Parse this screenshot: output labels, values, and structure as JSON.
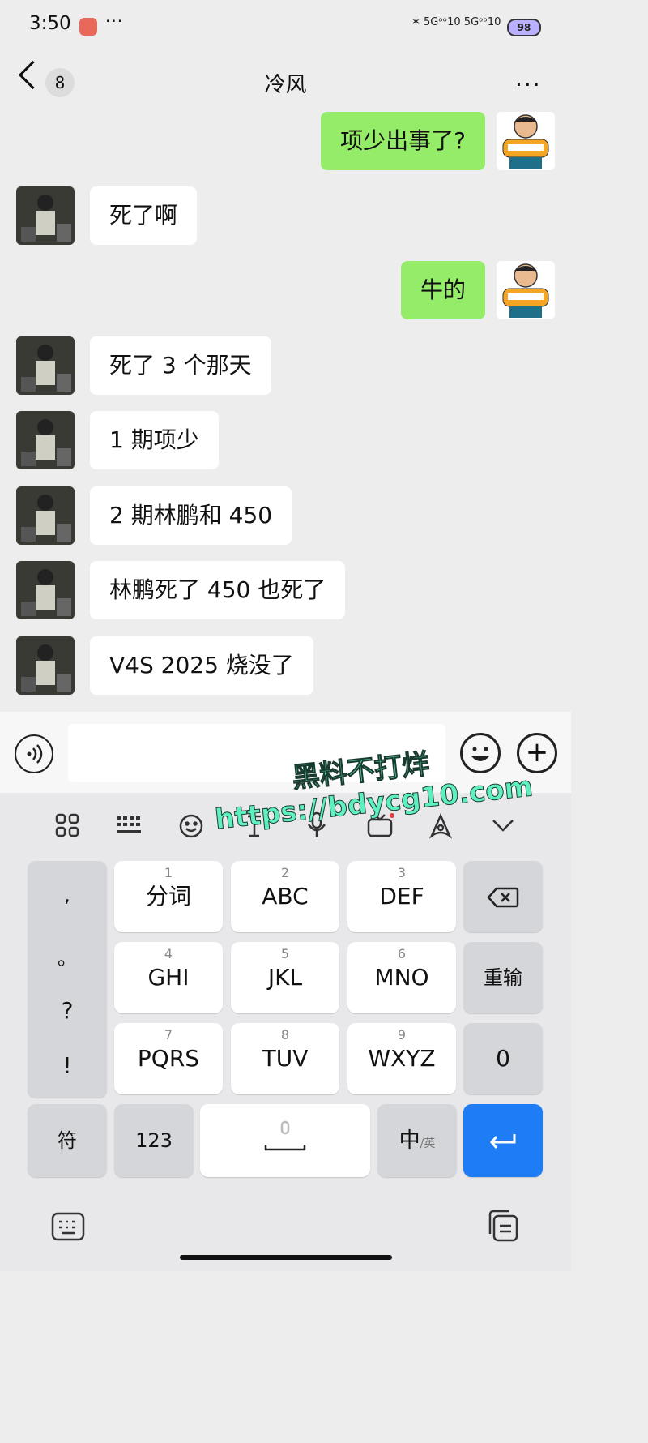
{
  "status_bar": {
    "time": "3:50",
    "more": "···",
    "signal": "✶  5Gᵒᵒ10  5Gᵒᵒ10",
    "battery": "98"
  },
  "header": {
    "back_count": "8",
    "title": "冷风",
    "more": "···"
  },
  "messages": [
    {
      "side": "right",
      "text": "项少出事了?"
    },
    {
      "side": "left",
      "text": "死了啊"
    },
    {
      "side": "right",
      "text": "牛的"
    },
    {
      "side": "left",
      "text": "死了 3 个那天"
    },
    {
      "side": "left",
      "text": "1 期项少"
    },
    {
      "side": "left",
      "text": "2 期林鹏和 450"
    },
    {
      "side": "left",
      "text": "林鹏死了 450 也死了"
    },
    {
      "side": "left",
      "text": "V4S 2025 烧没了"
    }
  ],
  "watermark": {
    "line1": "黑料不打烊",
    "line2": "https://bdycg10.com"
  },
  "keyboard": {
    "left_column": [
      ",",
      "。",
      "?",
      "!"
    ],
    "keys": [
      {
        "num": "1",
        "label": "分词"
      },
      {
        "num": "2",
        "label": "ABC"
      },
      {
        "num": "3",
        "label": "DEF"
      },
      {
        "num": "4",
        "label": "GHI"
      },
      {
        "num": "5",
        "label": "JKL"
      },
      {
        "num": "6",
        "label": "MNO"
      },
      {
        "num": "7",
        "label": "PQRS"
      },
      {
        "num": "8",
        "label": "TUV"
      },
      {
        "num": "9",
        "label": "WXYZ"
      }
    ],
    "delete": "⌫",
    "reenter": "重输",
    "zero": "0",
    "symbols": "符",
    "numbers": "123",
    "lang_main": "中",
    "lang_sub": "/英",
    "enter": "↵"
  },
  "colors": {
    "sent_bubble": "#95ec69",
    "received_bubble": "#ffffff",
    "enter_key": "#1e7cf4"
  }
}
